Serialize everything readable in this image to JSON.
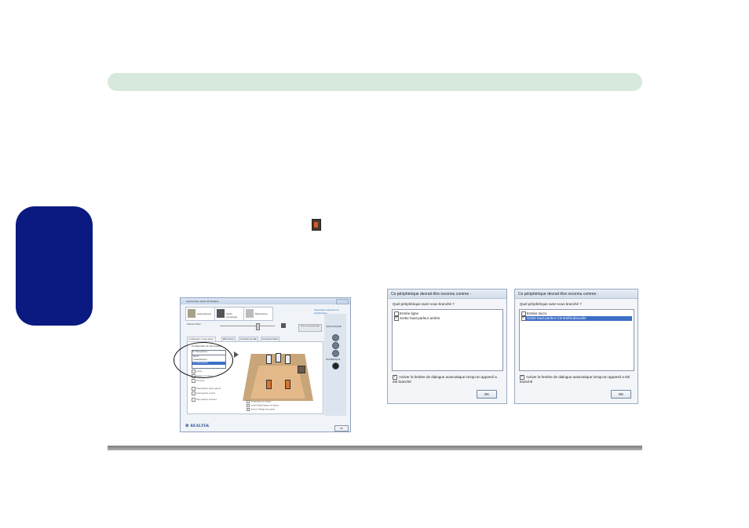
{
  "realtek_window": {
    "title": "Gestionnaire audio HD Realtek",
    "device_tabs": [
      "Haut-parleurs",
      "Sortie numérique",
      "Microphone"
    ],
    "link": "Paramètres avancés du périphérique",
    "volume_label": "Volume Princ.",
    "default_device_button": "Définir comme périphérique",
    "analog_label": "ANALOGIQUE",
    "digital_label": "NUMÉRIQUE",
    "tabs": [
      "Configuration du haut-parleur",
      "Effet Sonore",
      "Correction de salle",
      "Format par défaut"
    ],
    "config_label": "Configuration du haut-parleur",
    "dropdown_value": "5.1 Haut-parleurs",
    "dropdown_options": [
      "Stéréo",
      "Quadriphonique",
      "5.1 Haut-parleurs"
    ],
    "options": [
      "Centre",
      "Caisson de basses",
      "Surround",
      "Haut-parleurs pleine gamme",
      "Avant gauche et droit",
      "Haut-parleurs surround"
    ],
    "checks": [
      "Virtualisation du casque",
      "Centre/Swap/Caisson de basses",
      "Activer le filtrage des graves"
    ],
    "logo_text": "REALTEK",
    "ok_label": "OK"
  },
  "dialog_left": {
    "title": "Ce périphérique devrait être reconnu comme :",
    "question": "Quel périphérique avez-vous branché ?",
    "items": [
      {
        "label": "Entrée ligne",
        "checked": false,
        "selected": false
      },
      {
        "label": "Sortie haut-parleur arrière",
        "checked": true,
        "selected": false
      }
    ],
    "auto_dialog_label": "Activer la fenêtre de dialogue automatique lorsqu'un appareil a été branché",
    "ok_label": "OK"
  },
  "dialog_right": {
    "title": "Ce périphérique devrait être reconnu comme :",
    "question": "Quel périphérique avez-vous branché ?",
    "items": [
      {
        "label": "Entrée micro",
        "checked": false,
        "selected": false
      },
      {
        "label": "Sortie haut-parleur Central/Subwoofer",
        "checked": true,
        "selected": true
      }
    ],
    "auto_dialog_label": "Activer la fenêtre de dialogue automatique lorsqu'un appareil a été branché",
    "ok_label": "OK"
  },
  "colors": {
    "header_bar": "#d7e9dc",
    "side_tab": "#0a1a80",
    "selection": "#3c6fc5"
  }
}
